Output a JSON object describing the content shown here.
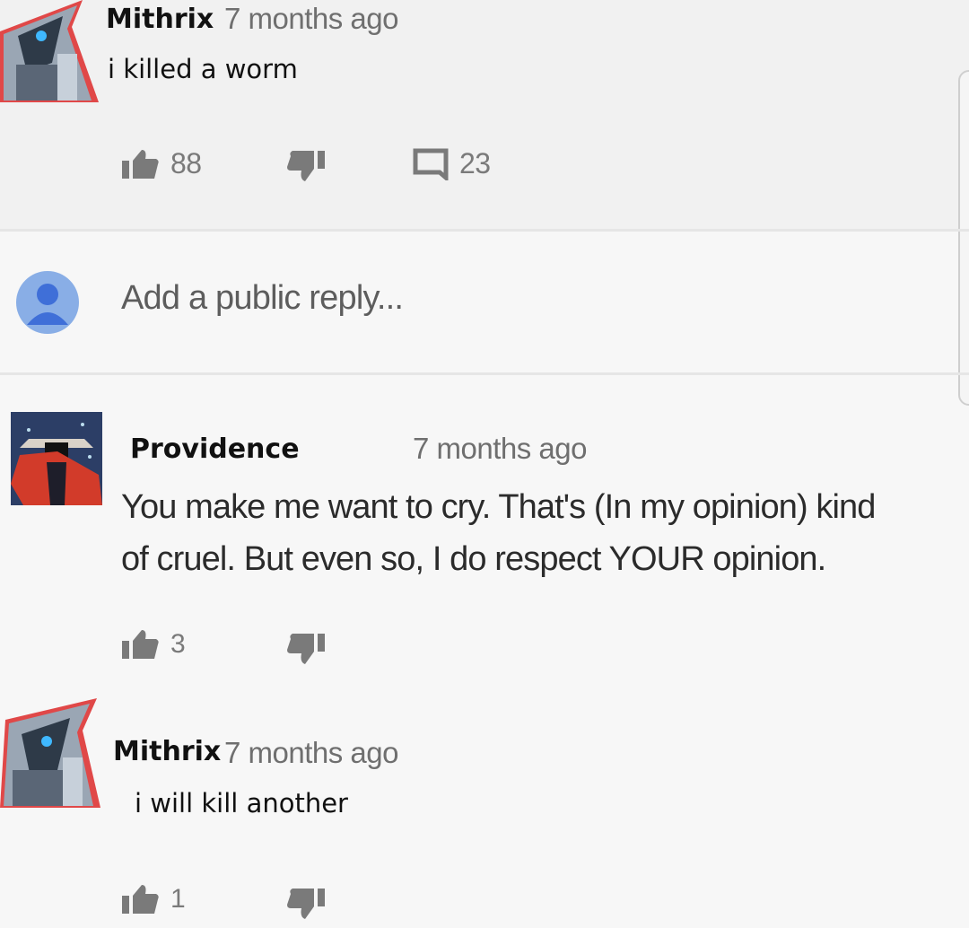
{
  "comments": [
    {
      "author": "Mithrix",
      "time": "7 months ago",
      "text": "i killed a worm",
      "likes": "88",
      "replies": "23"
    },
    {
      "author": "Providence",
      "time": "7 months ago",
      "text_line1": "You make me want to cry. That's (In my opinion) kind",
      "text_line2": "of cruel. But even so, I do respect YOUR opinion.",
      "likes": "3"
    },
    {
      "author": "Mithrix",
      "time": "7 months ago",
      "text": "i will kill another",
      "likes": "1"
    }
  ],
  "reply_box": {
    "placeholder": "Add a public reply..."
  },
  "icons": {
    "like": "thumbs-up-icon",
    "dislike": "thumbs-down-icon",
    "reply": "comment-icon",
    "user": "user-silhouette-icon"
  },
  "colors": {
    "reply_avatar": "#89aee6",
    "icon_gray": "#7a7a7a",
    "top_band": "#f1f1f1"
  }
}
